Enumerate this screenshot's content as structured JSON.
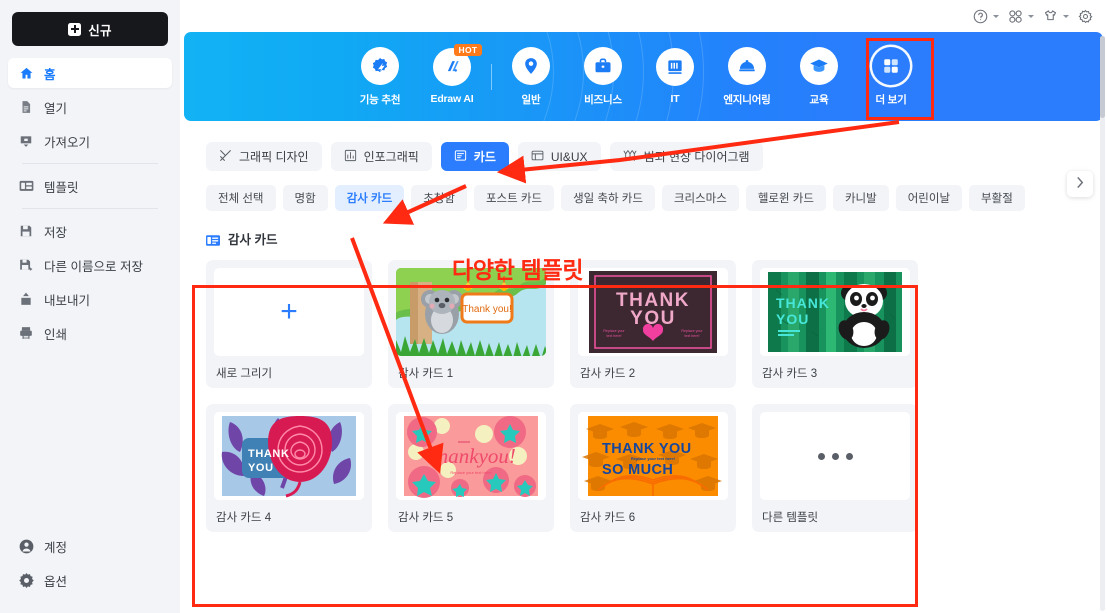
{
  "sidebar": {
    "new_button": {
      "label": "신규",
      "icon": "plus-square-icon"
    },
    "items": [
      {
        "label": "홈",
        "icon": "home-icon",
        "active": true
      },
      {
        "label": "열기",
        "icon": "file-open-icon",
        "active": false
      },
      {
        "label": "가져오기",
        "icon": "import-icon",
        "active": false
      },
      {
        "label": "템플릿",
        "icon": "template-icon",
        "active": false
      },
      {
        "label": "저장",
        "icon": "save-icon",
        "active": false
      },
      {
        "label": "다른 이름으로 저장",
        "icon": "save-as-icon",
        "active": false
      },
      {
        "label": "내보내기",
        "icon": "export-icon",
        "active": false
      },
      {
        "label": "인쇄",
        "icon": "print-icon",
        "active": false
      }
    ],
    "bottom_items": [
      {
        "label": "계정",
        "icon": "user-circle-icon"
      },
      {
        "label": "옵션",
        "icon": "gear-icon"
      }
    ]
  },
  "topbar": {
    "icons": [
      {
        "name": "help-icon",
        "has_caret": true
      },
      {
        "name": "apps-grid-icon",
        "has_caret": true
      },
      {
        "name": "theme-shirt-icon",
        "has_caret": true
      },
      {
        "name": "settings-gear-icon",
        "has_caret": false
      }
    ]
  },
  "banner": {
    "accent_start": "#12b2f5",
    "accent_end": "#2b7dfd",
    "hot_badge": "HOT",
    "nav": [
      {
        "label": "기능 추천",
        "icon": "feature-star-icon",
        "badge": null,
        "highlighted": false
      },
      {
        "label": "Edraw AI",
        "icon": "ai-icon",
        "badge": "HOT",
        "highlighted": false
      },
      {
        "label": "일반",
        "icon": "general-pin-icon",
        "badge": null,
        "highlighted": false
      },
      {
        "label": "비즈니스",
        "icon": "briefcase-icon",
        "badge": null,
        "highlighted": false
      },
      {
        "label": "IT",
        "icon": "server-icon",
        "badge": null,
        "highlighted": false
      },
      {
        "label": "엔지니어링",
        "icon": "hardhat-icon",
        "badge": null,
        "highlighted": false
      },
      {
        "label": "교육",
        "icon": "graduation-cap-icon",
        "badge": null,
        "highlighted": false
      },
      {
        "label": "더 보기",
        "icon": "grid-more-icon",
        "badge": null,
        "highlighted": true
      }
    ]
  },
  "tabs": [
    {
      "label": "그래픽 디자인",
      "icon": "graphic-design-icon",
      "selected": false
    },
    {
      "label": "인포그래픽",
      "icon": "infographic-icon",
      "selected": false
    },
    {
      "label": "카드",
      "icon": "card-icon",
      "selected": true
    },
    {
      "label": "UI&UX",
      "icon": "uiux-icon",
      "selected": false
    },
    {
      "label": "범죄 현장 다이어그램",
      "icon": "crime-scene-icon",
      "selected": false
    }
  ],
  "chips": [
    {
      "label": "전체 선택",
      "selected": false
    },
    {
      "label": "명함",
      "selected": false
    },
    {
      "label": "감사 카드",
      "selected": true
    },
    {
      "label": "초청함",
      "selected": false
    },
    {
      "label": "포스트 카드",
      "selected": false
    },
    {
      "label": "생일 축하 카드",
      "selected": false
    },
    {
      "label": "크리스마스",
      "selected": false
    },
    {
      "label": "헬로윈 카드",
      "selected": false
    },
    {
      "label": "카니발",
      "selected": false
    },
    {
      "label": "어린이날",
      "selected": false
    },
    {
      "label": "부활절",
      "selected": false
    }
  ],
  "chip_next_icon": "chevron-right-icon",
  "section": {
    "title": "감사 카드",
    "icon": "card-section-icon"
  },
  "cards": [
    {
      "label": "새로 그리기",
      "kind": "new"
    },
    {
      "label": "감사 카드 1",
      "kind": "koala"
    },
    {
      "label": "감사 카드 2",
      "kind": "thankyou-dark",
      "text1": "THANK",
      "text2": "YOU"
    },
    {
      "label": "감사 카드 3",
      "kind": "panda",
      "text1": "THANK",
      "text2": "YOU"
    },
    {
      "label": "감사 카드 4",
      "kind": "rose",
      "text1": "THANK",
      "text2": "YOU"
    },
    {
      "label": "감사 카드 5",
      "kind": "pink-stars",
      "text1": "Thankyou!"
    },
    {
      "label": "감사 카드 6",
      "kind": "orange-grad",
      "text1": "THANK  YOU",
      "text2": "SO  MUCH"
    },
    {
      "label": "다른 템플릿",
      "kind": "more"
    }
  ],
  "card_inner_text": {
    "koala_sign": "Thank you!"
  },
  "annotation": {
    "text": "다양한 템플릿",
    "color": "#ff2a11"
  }
}
